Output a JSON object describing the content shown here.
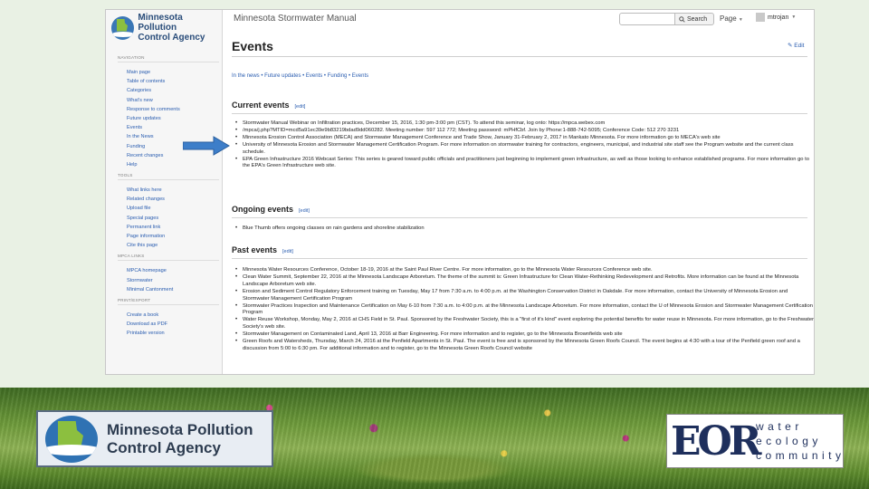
{
  "sidebar": {
    "logo_text": [
      "Minnesota Pollution",
      "Control Agency"
    ],
    "sections": [
      {
        "title": "NAVIGATION",
        "items": [
          "Main page",
          "Table of contents",
          "Categories",
          "What's new",
          "Response to comments",
          "Future updates",
          "Events",
          "In the News",
          "Funding",
          "Recent changes",
          "Help"
        ]
      },
      {
        "title": "TOOLS",
        "items": [
          "What links here",
          "Related changes",
          "Upload file",
          "Special pages",
          "Permanent link",
          "Page information",
          "Cite this page"
        ]
      },
      {
        "title": "MPCA LINKS",
        "items": [
          "MPCA homepage",
          "Stormwater",
          "Minimal Cantonment"
        ]
      },
      {
        "title": "PRINT/EXPORT",
        "items": [
          "Create a book",
          "Download as PDF",
          "Printable version"
        ]
      }
    ]
  },
  "topbar": {
    "site_title": "Minnesota Stormwater Manual",
    "search_label": "Search",
    "page_menu": "Page",
    "user": "mtrojan"
  },
  "page": {
    "title": "Events",
    "edit": "Edit",
    "breadcrumbs": "In the news • Future updates • Events • Funding • Events"
  },
  "current_events": {
    "heading": "Current events",
    "edit": "[edit]",
    "items": [
      {
        "text": "Stormwater Manual Webinar on Infiltration practices, December 15, 2016, 1:30 pm-3:00 pm (CST). To attend this seminar, log onto: https://mpca.webex.com",
        "link": ""
      },
      {
        "text": "/mpca/j.php?MTID=mcd5a91ec39e9b83219bdad9dd060282. Meeting number: 597 112 772; Meeting password: mPHfCbf. Join by Phone:1-888-742-5095; Conference Code: 512 270 3231",
        "link": ""
      },
      {
        "text": "Minnesota Erosion Control Association (MECA) and Stormwater Management Conference and Trade Show, January 31-February 2, 2017 in Mankato Minnesota. For more information go to MECA's web site",
        "link": ""
      },
      {
        "text": "University of Minnesota Erosion and Stormwater Management Certification Program. For more information on stormwater training for contractors, engineers, municipal, and industrial site staff see the Program website and the current class schedule.",
        "link": ""
      },
      {
        "text": "EPA Green Infrastructure 2016 Webcast Series: This series is geared toward public officials and practitioners just beginning to implement green infrastructure, as well as those looking to enhance established programs. For more information go to the EPA's Green Infrastructure web site.",
        "link": ""
      }
    ]
  },
  "ongoing_events": {
    "heading": "Ongoing events",
    "edit": "[edit]",
    "items": [
      {
        "text": "Blue Thumb offers ongoing classes on rain gardens and shoreline stabilization",
        "link": ""
      }
    ]
  },
  "past_events": {
    "heading": "Past events",
    "edit": "[edit]",
    "items": [
      {
        "text": "Minnesota Water Resources Conference, October 18-19, 2016 at the Saint Paul River Centre. For more information, go to the Minnesota Water Resources Conference web site.",
        "link": ""
      },
      {
        "text": "Clean Water Summit, September 22, 2016 at the Minnesota Landscape Arboretum. The theme of the summit is: Green Infrastructure for Clean Water-Rethinking Redevelopment and Retrofits. More information can be found at the Minnesota Landscape Arboretum web site.",
        "link": ""
      },
      {
        "text": "Erosion and Sediment Control Regulatory Enforcement training on Tuesday, May 17 from 7:30 a.m. to 4:00 p.m. at the Washington Conservation District in Oakdale. For more information, contact the University of Minnesota Erosion and Stormwater Management Certification Program",
        "link": ""
      },
      {
        "text": "Stormwater Practices Inspection and Maintenance Certification on May 6-10 from 7:30 a.m. to 4:00 p.m. at the Minnesota Landscape Arboretum. For more information, contact the U of Minnesota Erosion and Stormwater Management Certification Program",
        "link": ""
      },
      {
        "text": "Water Reuse Workshop, Monday, May 2, 2016 at CHS Field in St. Paul. Sponsored by the Freshwater Society, this is a \"first of it's kind\" event exploring the potential benefits for water reuse in Minnesota. For more information, go to the Freshwater Society's web site.",
        "link": ""
      },
      {
        "text": "Stormwater Management on Contaminated Land, April 13, 2016 at Barr Engineering. For more information and to register, go to the Minnesota Brownfields web site",
        "link": ""
      },
      {
        "text": "Green Roofs and Watersheds, Thursday, March 24, 2016 at the Penfield Apartments in St. Paul. The event is free and is sponsored by the Minnesota Green Roofs Council. The event begins at 4:30 with a tour of the Penfield green roof and a discussion from 5:00 to 6:30 pm. For additional information and to register, go to the Minnesota Green Roofs Council website",
        "link": ""
      }
    ]
  },
  "logos": {
    "mpca": [
      "Minnesota Pollution",
      "Control Agency"
    ],
    "eor": "EOR",
    "eor_words": [
      "water",
      "ecology",
      "community"
    ]
  },
  "colors": {
    "link": "#2a5db0",
    "arrow": "#3d7ec9",
    "background": "#e9f1e4"
  }
}
